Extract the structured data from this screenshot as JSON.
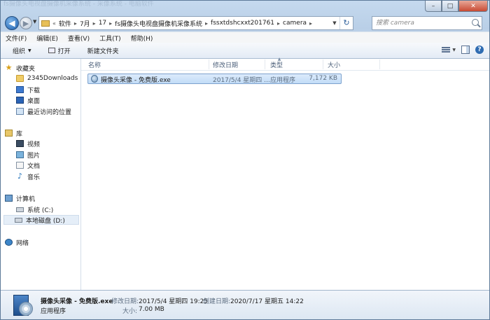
{
  "title_bar": {
    "ghost_text": "fs摄像头电视盘摄像机采像系统 - 采像系统 - 电脑软件"
  },
  "nav": {
    "back_glyph": "◀",
    "forward_glyph": "▶",
    "recent_glyph": "▼",
    "breadcrumb_prefix": "«",
    "breadcrumbs": [
      "软件",
      "7月",
      "17",
      "fs摄像头电视盘摄像机采像系统",
      "fssxtdshcxxt201761",
      "camera"
    ],
    "refresh_glyph": "↻",
    "search_placeholder": "搜索 camera"
  },
  "menu": [
    "文件(F)",
    "编辑(E)",
    "查看(V)",
    "工具(T)",
    "帮助(H)"
  ],
  "toolbar": {
    "organize": "组织",
    "open": "打开",
    "new_folder": "新建文件夹",
    "help": "?"
  },
  "sidebar": {
    "favorites": "收藏夹",
    "favorites_items": [
      "2345Downloads",
      "下载",
      "桌面",
      "最近访问的位置"
    ],
    "libraries": "库",
    "library_items": [
      "视频",
      "图片",
      "文档",
      "音乐"
    ],
    "computer": "计算机",
    "computer_items": [
      "系统 (C:)",
      "本地磁盘 (D:)"
    ],
    "network": "网络"
  },
  "columns": {
    "name": "名称",
    "date": "修改日期",
    "type": "类型",
    "size": "大小"
  },
  "files": [
    {
      "name": "摄像头采像 - 免费版.exe",
      "date": "2017/5/4 星期四 ...",
      "type": "应用程序",
      "size": "7,172 KB"
    }
  ],
  "details": {
    "file_name": "摄像头采像 - 免费版.exe",
    "file_type": "应用程序",
    "modified_label": "修改日期:",
    "modified_value": "2017/5/4 星期四 19:25",
    "created_label": "创建日期:",
    "created_value": "2020/7/17 星期五 14:22",
    "size_label": "大小:",
    "size_value": "7.00 MB"
  },
  "colors": {
    "selection": "#c2dcf7",
    "frame": "#b9cfe7",
    "close_button": "#c84a33"
  }
}
